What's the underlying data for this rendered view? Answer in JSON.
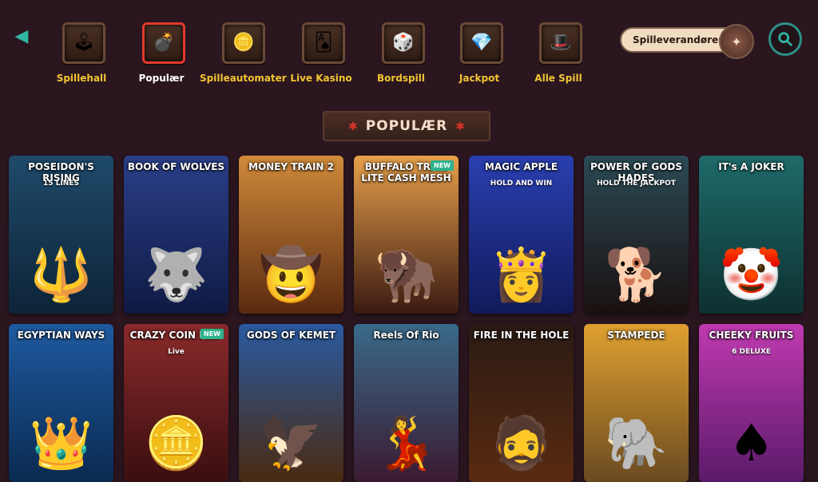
{
  "nav": {
    "back_icon": "chevron-left-icon",
    "categories": [
      {
        "label": "Spillehall",
        "icon": "arcade-icon",
        "glyph": "🕹",
        "active": false
      },
      {
        "label": "Populær",
        "icon": "bomb-icon",
        "glyph": "💣",
        "active": true
      },
      {
        "label": "Spilleautomater",
        "icon": "coin-icon",
        "glyph": "🪙",
        "active": false
      },
      {
        "label": "Live Kasino",
        "icon": "cards-icon",
        "glyph": "🂡",
        "active": false
      },
      {
        "label": "Bordspill",
        "icon": "dice-icon",
        "glyph": "🎲",
        "active": false
      },
      {
        "label": "Jackpot",
        "icon": "gem-icon",
        "glyph": "💎",
        "active": false
      },
      {
        "label": "Alle Spill",
        "icon": "hat-icon",
        "glyph": "🎩",
        "active": false
      }
    ],
    "providers_label": "Spilleverandører",
    "search_icon": "search-icon"
  },
  "section": {
    "title": "POPULÆR"
  },
  "games": [
    {
      "name": "POSEIDON'S RISING",
      "sub": "15 LINES",
      "new": false,
      "bg": "#1f4a6a",
      "bg2": "#0d2438",
      "fig": "🔱"
    },
    {
      "name": "BOOK OF WOLVES",
      "sub": "",
      "new": false,
      "bg": "#2a3f88",
      "bg2": "#0f1a44",
      "fig": "🐺"
    },
    {
      "name": "MONEY TRAIN 2",
      "sub": "",
      "new": false,
      "bg": "#d08a3a",
      "bg2": "#5a2a10",
      "fig": "🤠"
    },
    {
      "name": "BUFFALO TRAIL LITE CASH MESH",
      "sub": "",
      "new": true,
      "bg": "#e7a04a",
      "bg2": "#3a1a10",
      "fig": "🦬"
    },
    {
      "name": "MAGIC APPLE",
      "sub": "HOLD AND WIN",
      "new": false,
      "bg": "#2a3fb0",
      "bg2": "#101a5a",
      "fig": "👸"
    },
    {
      "name": "POWER OF GODS HADES",
      "sub": "HOLD THE JACKPOT",
      "new": false,
      "bg": "#2b4a55",
      "bg2": "#1a1010",
      "fig": "🐕"
    },
    {
      "name": "IT's A JOKER",
      "sub": "",
      "new": false,
      "bg": "#1f6a6a",
      "bg2": "#0e3030",
      "fig": "🤡"
    },
    {
      "name": "EGYPTIAN WAYS",
      "sub": "",
      "new": false,
      "bg": "#1f5aa0",
      "bg2": "#0a2a50",
      "fig": "👑"
    },
    {
      "name": "CRAZY COIN FLIP",
      "sub": "Live",
      "new": true,
      "bg": "#8a2a2a",
      "bg2": "#3a0e10",
      "fig": "🪙"
    },
    {
      "name": "GODS OF KEMET",
      "sub": "",
      "new": false,
      "bg": "#2a5aa0",
      "bg2": "#4a2a10",
      "fig": "🦅"
    },
    {
      "name": "Reels Of Rio",
      "sub": "",
      "new": false,
      "bg": "#3a6a8a",
      "bg2": "#3a1a30",
      "fig": "💃"
    },
    {
      "name": "FIRE IN THE HOLE",
      "sub": "",
      "new": false,
      "bg": "#2a1a14",
      "bg2": "#5a2a10",
      "fig": "🧔"
    },
    {
      "name": "STAMPEDE",
      "sub": "",
      "new": false,
      "bg": "#e0a030",
      "bg2": "#6a4a20",
      "fig": "🐘"
    },
    {
      "name": "CHEEKY FRUITS",
      "sub": "6 DELUXE",
      "new": false,
      "bg": "#c03ab0",
      "bg2": "#5a1a6a",
      "fig": "♠"
    }
  ]
}
